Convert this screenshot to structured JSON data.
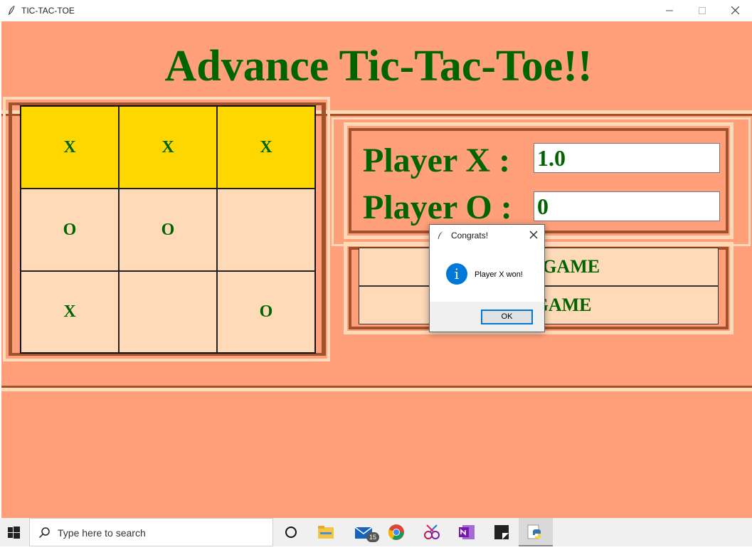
{
  "window": {
    "title": "TIC-TAC-TOE"
  },
  "app": {
    "heading": "Advance Tic-Tac-Toe!!",
    "board": [
      [
        {
          "mark": "X",
          "highlight": true
        },
        {
          "mark": "X",
          "highlight": true
        },
        {
          "mark": "X",
          "highlight": true
        }
      ],
      [
        {
          "mark": "O",
          "highlight": false
        },
        {
          "mark": "O",
          "highlight": false
        },
        {
          "mark": "",
          "highlight": false
        }
      ],
      [
        {
          "mark": "X",
          "highlight": false
        },
        {
          "mark": "",
          "highlight": false
        },
        {
          "mark": "O",
          "highlight": false
        }
      ]
    ],
    "score": {
      "player_x_label": "Player X :",
      "player_x_value": "1.0",
      "player_o_label": "Player O :",
      "player_o_value": "0"
    },
    "buttons": {
      "reset_label": "RESET GAME",
      "new_label": "NEW GAME"
    }
  },
  "dialog": {
    "title": "Congrats!",
    "message": "Player X won!",
    "ok_label": "OK",
    "icon": "info-icon"
  },
  "taskbar": {
    "search_placeholder": "Type here to search",
    "mail_badge": "15",
    "icons": [
      "windows-start-icon",
      "cortana-icon",
      "file-explorer-icon",
      "mail-icon",
      "chrome-icon",
      "snip-sketch-icon",
      "onenote-icon",
      "sticky-notes-icon",
      "python-icon"
    ]
  },
  "colors": {
    "background": "#FFA07A",
    "cell": "#FFDAB9",
    "win_cell": "#FFD700",
    "text": "#006400",
    "frame": "#A0522D",
    "accent": "#0078D7"
  }
}
